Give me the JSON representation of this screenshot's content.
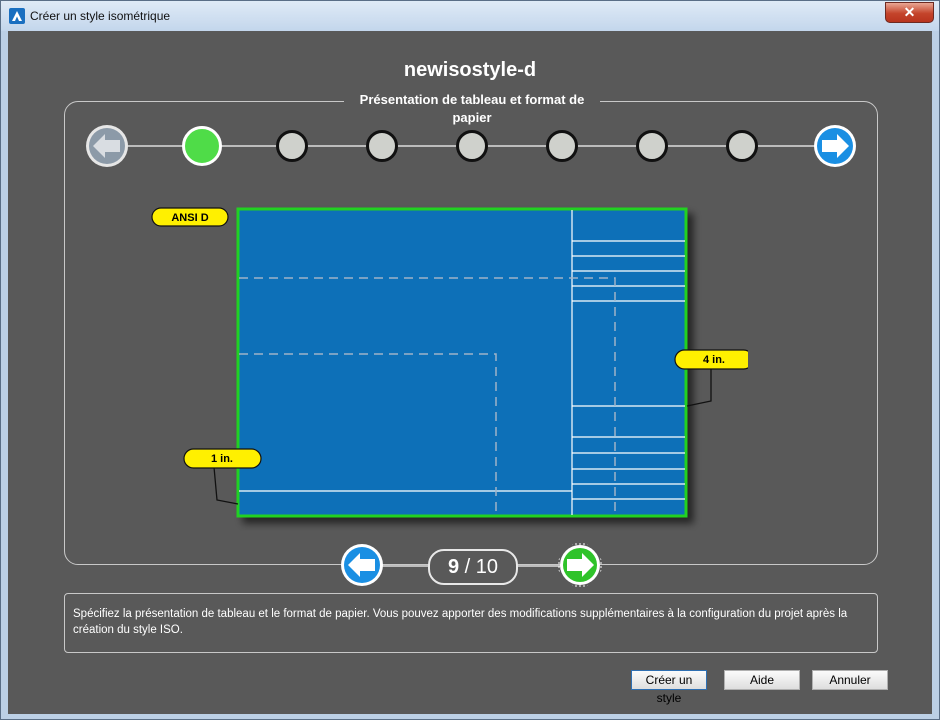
{
  "window": {
    "title": "Créer un style isométrique",
    "close_glyph": "✕"
  },
  "wizard": {
    "style_name": "newisostyle-d",
    "section_title": "Présentation de tableau et format de papier",
    "paper_size_label": "ANSI D",
    "right_callout": "4 in.",
    "left_callout": "1 in.",
    "current_page": "9",
    "page_separator": "/",
    "total_pages": "10",
    "description": "Spécifiez la présentation de tableau et le format de papier. Vous pouvez apporter des modifications supplémentaires à la configuration du projet après la création du style ISO."
  },
  "steps": {
    "total": 9,
    "completed": 1
  },
  "buttons": {
    "create": "Créer un style",
    "help": "Aide",
    "cancel": "Annuler"
  },
  "colors": {
    "sheet_blue": "#0b6fb8",
    "sheet_border": "#22d122",
    "callout_yellow": "#fff000",
    "accent_blue": "#1a8fe3",
    "accent_green": "#2fc32a",
    "background": "#595959"
  },
  "icons": [
    "app-icon",
    "close-icon",
    "back-arrow-icon",
    "forward-arrow-icon"
  ]
}
